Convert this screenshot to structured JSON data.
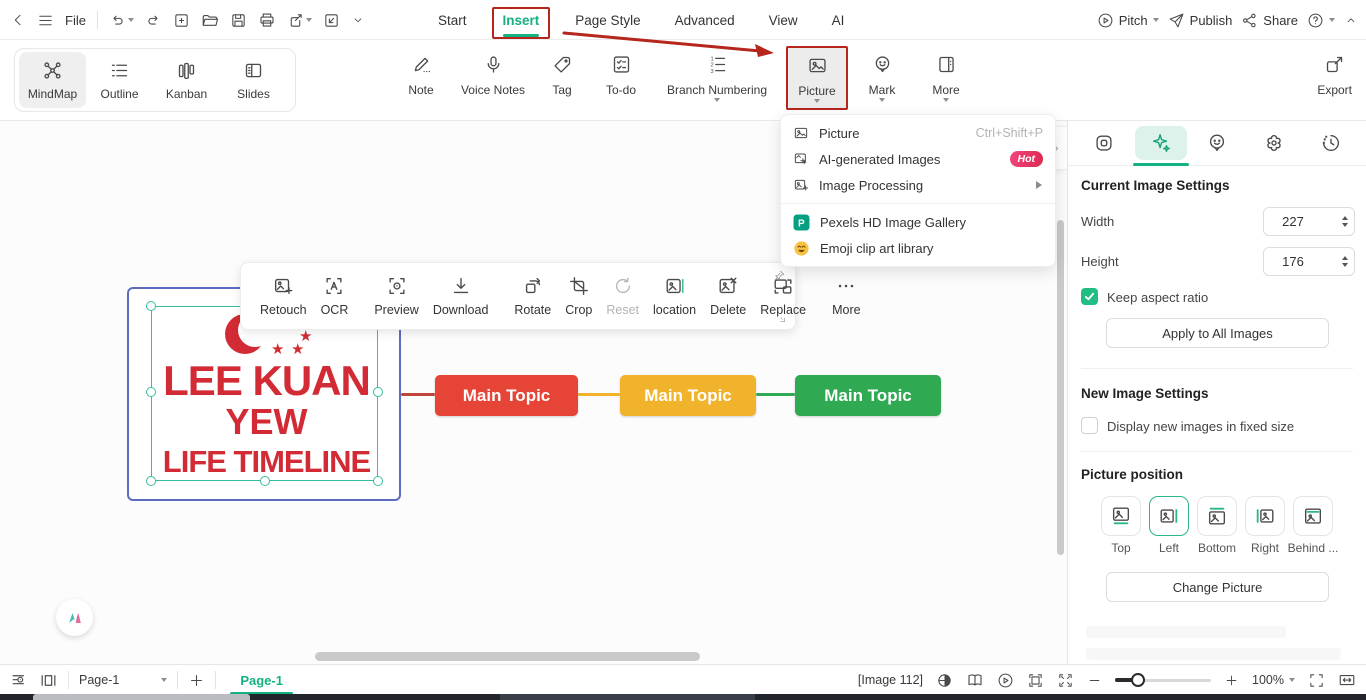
{
  "app": {
    "accent_green": "#15b183",
    "annotation_red": "#b5261d",
    "selection_teal": "#35bfa0",
    "node_border_blue": "#5e6cc0"
  },
  "titlebar": {
    "file_label": "File",
    "tabs": [
      {
        "label": "Start"
      },
      {
        "label": "Insert"
      },
      {
        "label": "Page Style"
      },
      {
        "label": "Advanced"
      },
      {
        "label": "View"
      },
      {
        "label": "AI"
      }
    ],
    "pitch_label": "Pitch",
    "publish_label": "Publish",
    "share_label": "Share"
  },
  "toolbar": {
    "view_modes": [
      {
        "label": "MindMap"
      },
      {
        "label": "Outline"
      },
      {
        "label": "Kanban"
      },
      {
        "label": "Slides"
      }
    ],
    "tools": [
      {
        "label": "Note"
      },
      {
        "label": "Voice Notes"
      },
      {
        "label": "Tag"
      },
      {
        "label": "To-do"
      },
      {
        "label": "Branch Numbering"
      },
      {
        "label": "Picture"
      },
      {
        "label": "Mark"
      },
      {
        "label": "More"
      }
    ],
    "export_label": "Export"
  },
  "picture_menu": {
    "item_picture": "Picture",
    "shortcut_picture": "Ctrl+Shift+P",
    "item_ai": "AI-generated Images",
    "badge_hot": "Hot",
    "item_processing": "Image Processing",
    "item_pexels": "Pexels HD Image Gallery",
    "item_emoji": "Emoji clip art library"
  },
  "image_toolbar": {
    "retouch": "Retouch",
    "ocr": "OCR",
    "preview": "Preview",
    "download": "Download",
    "rotate": "Rotate",
    "crop": "Crop",
    "reset": "Reset",
    "location": "location",
    "delete": "Delete",
    "replace": "Replace",
    "more": "More"
  },
  "canvas": {
    "image_title_line1": "LEE KUAN",
    "image_title_line2": "YEW",
    "image_title_line3": "LIFE TIMELINE",
    "topics": [
      {
        "label": "Main Topic",
        "color": "#e54437"
      },
      {
        "label": "Main Topic",
        "color": "#f1b32b"
      },
      {
        "label": "Main Topic",
        "color": "#2fa952"
      }
    ]
  },
  "right_panel": {
    "title": "Current Image Settings",
    "width_label": "Width",
    "width_value": "227",
    "height_label": "Height",
    "height_value": "176",
    "keep_aspect_label": "Keep aspect ratio",
    "apply_all_label": "Apply to All Images",
    "new_settings_title": "New Image Settings",
    "fixed_size_label": "Display new images in fixed size",
    "position_title": "Picture position",
    "positions": [
      {
        "label": "Top"
      },
      {
        "label": "Left"
      },
      {
        "label": "Bottom"
      },
      {
        "label": "Right"
      },
      {
        "label": "Behind ..."
      }
    ],
    "change_picture_label": "Change Picture"
  },
  "status_bar": {
    "page_select_value": "Page-1",
    "page_tab_label": "Page-1",
    "selection_info": "[Image 112]",
    "zoom_value": "100%"
  }
}
